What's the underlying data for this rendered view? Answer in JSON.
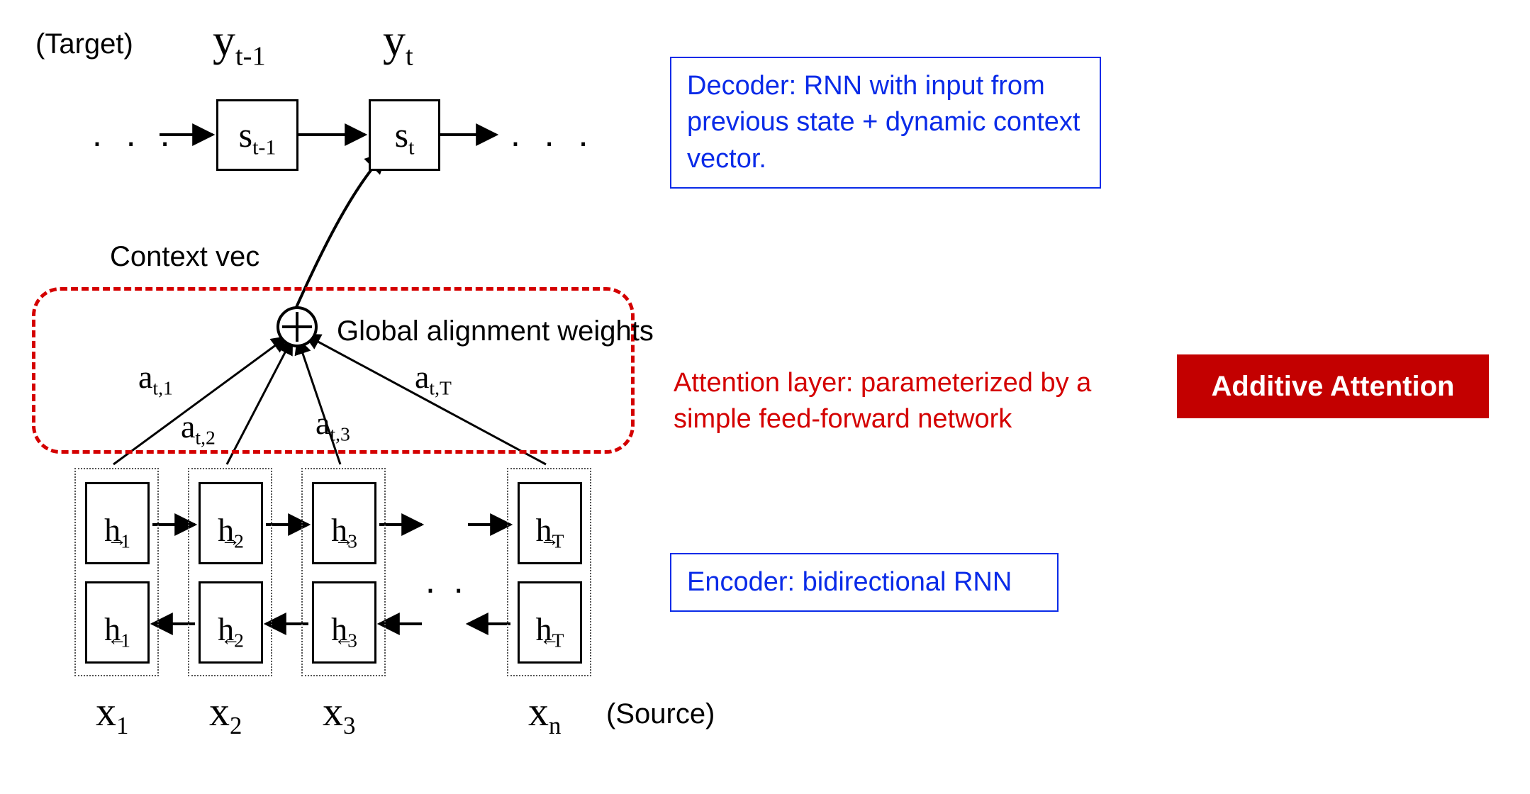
{
  "diagram": {
    "labels": {
      "target": "(Target)",
      "source": "(Source)",
      "context_vec": "Context vec",
      "global_alignment": "Global alignment weights"
    },
    "decoder": {
      "states_html": [
        "s<span class='sub'>t-1</span>",
        "s<span class='sub'>t</span>"
      ],
      "outputs_html": [
        "y<span class='sub'>t-1</span>",
        "y<span class='sub'>t</span>"
      ]
    },
    "attention": {
      "weights_html": [
        "a<span class='sub'>t,1</span>",
        "a<span class='sub'>t,2</span>",
        "a<span class='sub'>t,3</span>",
        "a<span class='sub'>t,T</span>"
      ]
    },
    "encoder": {
      "inputs_html": [
        "x<span class='sub'>1</span>",
        "x<span class='sub'>2</span>",
        "x<span class='sub'>3</span>",
        "x<span class='sub'>n</span>"
      ],
      "fwd_html": [
        "h<span class='sub'>1</span>",
        "h<span class='sub'>2</span>",
        "h<span class='sub'>3</span>",
        "h<span class='sub'>T</span>"
      ],
      "bwd_html": [
        "h<span class='sub'>1</span>",
        "h<span class='sub'>2</span>",
        "h<span class='sub'>3</span>",
        "h<span class='sub'>T</span>"
      ]
    },
    "callouts": {
      "decoder_box": "Decoder: RNN with input from previous state + dynamic context vector.",
      "attention_box": "Attention layer: parameterized by a simple feed-forward network",
      "encoder_box": "Encoder: bidirectional RNN"
    },
    "badge": "Additive Attention",
    "colors": {
      "blue": "#0a2be8",
      "red": "#d40000",
      "badge_bg": "#c30000"
    }
  },
  "chart_data": {
    "type": "diagram",
    "title": "Encoder-decoder with additive attention (Bahdanau)",
    "nodes": [
      {
        "id": "x1",
        "type": "input",
        "label": "x_1"
      },
      {
        "id": "x2",
        "type": "input",
        "label": "x_2"
      },
      {
        "id": "x3",
        "type": "input",
        "label": "x_3"
      },
      {
        "id": "xn",
        "type": "input",
        "label": "x_n"
      },
      {
        "id": "hf1",
        "type": "enc_fwd",
        "label": "h→_1"
      },
      {
        "id": "hf2",
        "type": "enc_fwd",
        "label": "h→_2"
      },
      {
        "id": "hf3",
        "type": "enc_fwd",
        "label": "h→_3"
      },
      {
        "id": "hfT",
        "type": "enc_fwd",
        "label": "h→_T"
      },
      {
        "id": "hb1",
        "type": "enc_bwd",
        "label": "h←_1"
      },
      {
        "id": "hb2",
        "type": "enc_bwd",
        "label": "h←_2"
      },
      {
        "id": "hb3",
        "type": "enc_bwd",
        "label": "h←_3"
      },
      {
        "id": "hbT",
        "type": "enc_bwd",
        "label": "h←_T"
      },
      {
        "id": "sum",
        "type": "combine",
        "label": "⊕ (context vector c_t)"
      },
      {
        "id": "st1",
        "type": "dec_state",
        "label": "s_{t-1}"
      },
      {
        "id": "st",
        "type": "dec_state",
        "label": "s_t"
      },
      {
        "id": "yt1",
        "type": "output",
        "label": "y_{t-1}"
      },
      {
        "id": "yt",
        "type": "output",
        "label": "y_t"
      }
    ],
    "edges": [
      {
        "from": "hf1",
        "to": "hf2"
      },
      {
        "from": "hf2",
        "to": "hf3"
      },
      {
        "from": "hf3",
        "to": "hfT",
        "style": "dots"
      },
      {
        "from": "hbT",
        "to": "hb3",
        "style": "dots"
      },
      {
        "from": "hb3",
        "to": "hb2"
      },
      {
        "from": "hb2",
        "to": "hb1"
      },
      {
        "from": "hf1",
        "to": "sum",
        "label": "a_{t,1}"
      },
      {
        "from": "hf2",
        "to": "sum",
        "label": "a_{t,2}"
      },
      {
        "from": "hf3",
        "to": "sum",
        "label": "a_{t,3}"
      },
      {
        "from": "hfT",
        "to": "sum",
        "label": "a_{t,T}"
      },
      {
        "from": "sum",
        "to": "st"
      },
      {
        "from": "st1",
        "to": "st"
      },
      {
        "from": "st1",
        "to": "yt1"
      },
      {
        "from": "st",
        "to": "yt"
      }
    ],
    "groups": [
      {
        "name": "Attention layer: parameterized by a simple feed-forward network",
        "contains": [
          "sum"
        ],
        "style": "red-dashed"
      },
      {
        "name": "Encoder: bidirectional RNN",
        "contains": [
          "hf1",
          "hf2",
          "hf3",
          "hfT",
          "hb1",
          "hb2",
          "hb3",
          "hbT"
        ]
      },
      {
        "name": "Decoder: RNN with input from previous state + dynamic context vector.",
        "contains": [
          "st1",
          "st"
        ]
      }
    ],
    "badge": "Additive Attention"
  }
}
